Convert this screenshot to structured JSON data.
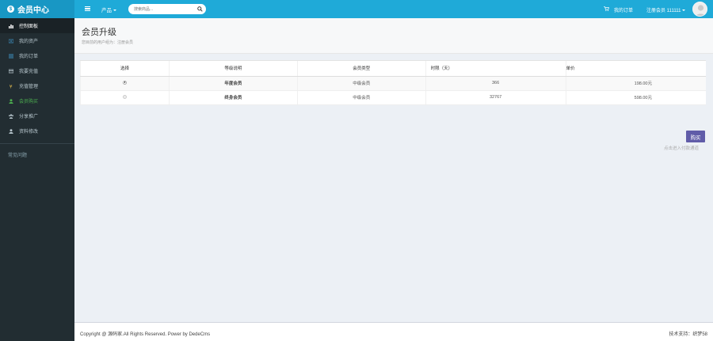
{
  "header": {
    "logo_glyph": "$",
    "logo": "会员中心",
    "nav_product": "产品",
    "search_placeholder": "搜索商品...",
    "my_orders": "我的订单",
    "user": "注册会员 111111"
  },
  "sidebar": {
    "items": [
      {
        "label": "控制面板"
      },
      {
        "label": "我的资产"
      },
      {
        "label": "我的订单"
      },
      {
        "label": "我要充值"
      },
      {
        "label": "充值管理"
      },
      {
        "label": "会员购买"
      },
      {
        "label": "分享推广"
      },
      {
        "label": "资料修改"
      }
    ],
    "faq": "常见问题"
  },
  "page": {
    "title": "会员升级",
    "subtitle": "您目前的用户组为：注册会员"
  },
  "table": {
    "headers": [
      "选择",
      "等级说明",
      "会员类型",
      "时限（天）",
      "单价"
    ],
    "rows": [
      {
        "level": "年度会员",
        "type": "中级会员",
        "days": "366",
        "price": "198.00元",
        "checked": true
      },
      {
        "level": "终身会员",
        "type": "中级会员",
        "days": "32767",
        "price": "598.00元",
        "checked": false
      }
    ]
  },
  "buy": {
    "label": "购买",
    "note": "点击进入付款通道"
  },
  "footer": {
    "copyright": "Copyright @ 源码家.All Rights Reserved. Power by DedeCms",
    "tech": "技术支持：织梦58"
  },
  "colors": {
    "header": "#1faad8",
    "logo_bg": "#1897c4",
    "sidebar": "#222d32",
    "buy_button": "#605ca8",
    "active_green": "#4caf50"
  }
}
